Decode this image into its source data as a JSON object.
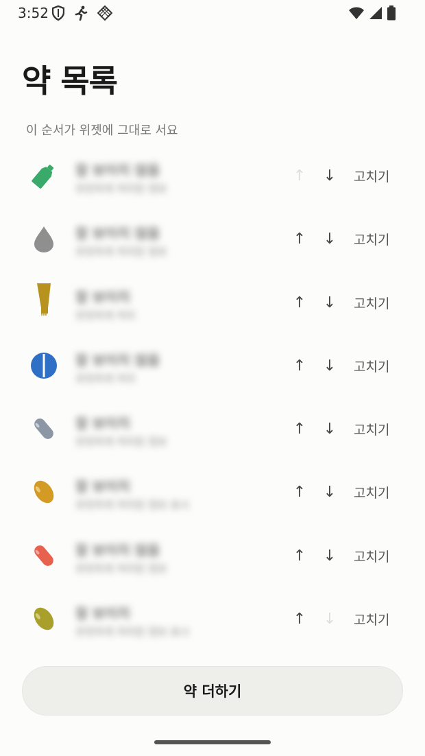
{
  "status_bar": {
    "time": "3:52",
    "left_icons": [
      "shield-icon",
      "running-icon",
      "diamond-grid-icon"
    ],
    "right_icons": [
      "wifi-icon",
      "signal-icon",
      "battery-icon"
    ]
  },
  "page": {
    "title": "약 목록",
    "subtitle": "이 순서가 위젯에 그대로 서요"
  },
  "medications": [
    {
      "icon": "bottle-icon",
      "color": "#3aaa6a",
      "name": "잘 보이지 않음",
      "detail": "흐릿하게 처리된 정보",
      "edit_label": "고치기",
      "up_arrow": "↑",
      "down_arrow": "↓",
      "up_enabled": false,
      "down_enabled": true
    },
    {
      "icon": "drop-icon",
      "color": "#8f8f8f",
      "name": "잘 보이지 않음",
      "detail": "흐릿하게 처리된 정보",
      "edit_label": "고치기",
      "up_arrow": "↑",
      "down_arrow": "↓",
      "up_enabled": true,
      "down_enabled": true
    },
    {
      "icon": "tube-icon",
      "color": "#b8921e",
      "name": "잘 보이지",
      "detail": "흐릿하게 처리",
      "edit_label": "고치기",
      "up_arrow": "↑",
      "down_arrow": "↓",
      "up_enabled": true,
      "down_enabled": true
    },
    {
      "icon": "round-tablet-icon",
      "color": "#2f6fc6",
      "name": "잘 보이지 않음",
      "detail": "흐릿하게 처리",
      "edit_label": "고치기",
      "up_arrow": "↑",
      "down_arrow": "↓",
      "up_enabled": true,
      "down_enabled": true
    },
    {
      "icon": "capsule-icon",
      "color": "#8c97a6",
      "name": "잘 보이지",
      "detail": "흐릿하게 처리된 정보",
      "edit_label": "고치기",
      "up_arrow": "↑",
      "down_arrow": "↓",
      "up_enabled": true,
      "down_enabled": true
    },
    {
      "icon": "oval-pill-icon",
      "color": "#d39a24",
      "name": "잘 보이지",
      "detail": "흐릿하게 처리된 정보 표시",
      "edit_label": "고치기",
      "up_arrow": "↑",
      "down_arrow": "↓",
      "up_enabled": true,
      "down_enabled": true
    },
    {
      "icon": "capsule-icon",
      "color": "#e8614f",
      "name": "잘 보이지 않음",
      "detail": "흐릿하게 처리된 정보",
      "edit_label": "고치기",
      "up_arrow": "↑",
      "down_arrow": "↓",
      "up_enabled": true,
      "down_enabled": true
    },
    {
      "icon": "oval-pill-icon",
      "color": "#a8a02a",
      "name": "잘 보이지",
      "detail": "흐릿하게 처리된 정보 표시",
      "edit_label": "고치기",
      "up_arrow": "↑",
      "down_arrow": "↓",
      "up_enabled": true,
      "down_enabled": false
    }
  ],
  "add_button_label": "약 더하기"
}
